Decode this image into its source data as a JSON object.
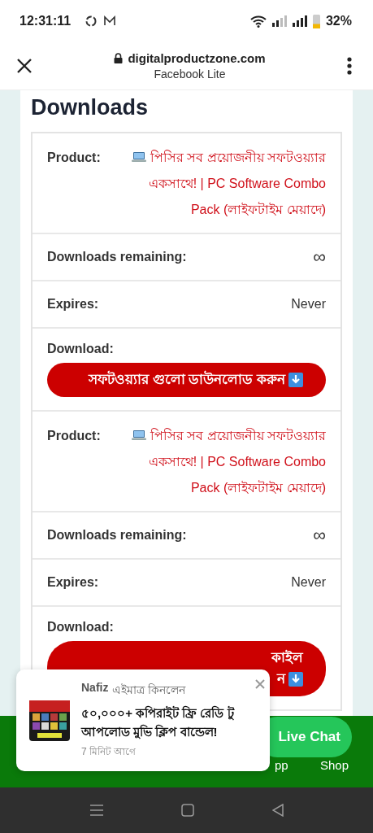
{
  "status_bar": {
    "time": "12:31:11",
    "battery": "32%"
  },
  "browser": {
    "domain": "digitalproductzone.com",
    "subtitle": "Facebook Lite"
  },
  "page": {
    "heading": "Downloads",
    "downloads": [
      {
        "product_label": "Product:",
        "product": "পিসির সব প্রয়োজনীয় সফটওয়্যার একসাথে! | PC Software Combo Pack (লাইফটাইম মেয়াদে)",
        "remaining_label": "Downloads remaining:",
        "remaining": "∞",
        "expires_label": "Expires:",
        "expires": "Never",
        "download_label": "Download:",
        "button_lines": [
          "সফটওয়্যার গুলো ডাউনলোড করুন"
        ]
      },
      {
        "product_label": "Product:",
        "product": "পিসির সব প্রয়োজনীয় সফটওয়্যার একসাথে! | PC Software Combo Pack (লাইফটাইম মেয়াদে)",
        "remaining_label": "Downloads remaining:",
        "remaining": "∞",
        "expires_label": "Expires:",
        "expires": "Never",
        "download_label": "Download:",
        "button_lines": [
          "কাইল",
          "ন"
        ]
      }
    ]
  },
  "bottom_bar": {
    "items": [
      "pp",
      "Shop"
    ],
    "live_chat": "Live Chat"
  },
  "popup": {
    "name": "Nafiz",
    "action": "এইমাত্র কিনলেন",
    "title": "৫০,০০০+ কপিরাইট ফ্রি রেডি টু আপলোড মুভি ক্লিপ বান্ডেল!",
    "time": "7 মিনিট আগে"
  }
}
